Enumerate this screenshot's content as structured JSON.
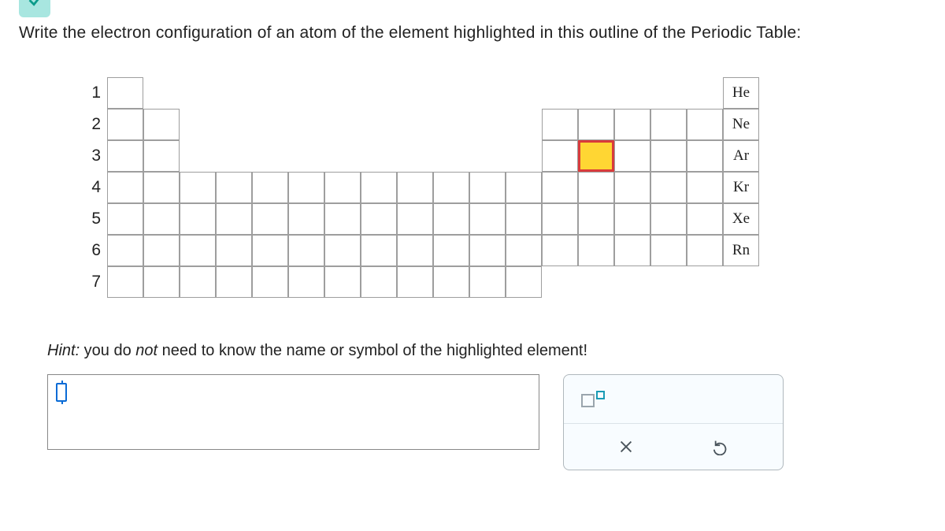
{
  "question": "Write the electron configuration of an atom of the element highlighted in this outline of the Periodic Table:",
  "hint_prefix": "Hint:",
  "hint_text_1": " you do ",
  "hint_not": "not",
  "hint_text_2": " need to know the name or symbol of the highlighted element!",
  "periodic": {
    "rows": [
      "1",
      "2",
      "3",
      "4",
      "5",
      "6",
      "7"
    ],
    "noble_gas_labels": [
      "He",
      "Ne",
      "Ar",
      "Kr",
      "Xe",
      "Rn"
    ],
    "highlighted": {
      "row": 3,
      "group": 14
    }
  },
  "chart_data": {
    "type": "table",
    "description": "Periodic table outline grid, 7 periods x 18 groups",
    "row_labels": [
      1,
      2,
      3,
      4,
      5,
      6,
      7
    ],
    "labeled_cells": [
      {
        "row": 1,
        "group": 18,
        "label": "He"
      },
      {
        "row": 2,
        "group": 18,
        "label": "Ne"
      },
      {
        "row": 3,
        "group": 18,
        "label": "Ar"
      },
      {
        "row": 4,
        "group": 18,
        "label": "Kr"
      },
      {
        "row": 5,
        "group": 18,
        "label": "Xe"
      },
      {
        "row": 6,
        "group": 18,
        "label": "Rn"
      }
    ],
    "highlighted_cell": {
      "row": 3,
      "group": 14,
      "fill": "#ffd633",
      "border": "#d93b3b"
    },
    "cell_layout": {
      "row1_groups": [
        1,
        18
      ],
      "row2_groups": [
        1,
        2,
        13,
        14,
        15,
        16,
        17,
        18
      ],
      "row3_groups": [
        1,
        2,
        13,
        14,
        15,
        16,
        17,
        18
      ],
      "row4_groups": [
        1,
        2,
        3,
        4,
        5,
        6,
        7,
        8,
        9,
        10,
        11,
        12,
        13,
        14,
        15,
        16,
        17,
        18
      ],
      "row5_groups": [
        1,
        2,
        3,
        4,
        5,
        6,
        7,
        8,
        9,
        10,
        11,
        12,
        13,
        14,
        15,
        16,
        17,
        18
      ],
      "row6_groups": [
        1,
        2,
        3,
        4,
        5,
        6,
        7,
        8,
        9,
        10,
        11,
        12,
        13,
        14,
        15,
        16,
        17,
        18
      ],
      "row7_groups": [
        1,
        2,
        3,
        4,
        5,
        6,
        7,
        8,
        9,
        10,
        11,
        12
      ]
    }
  },
  "tools": {
    "superscript": "superscript",
    "clear": "clear",
    "reset": "reset"
  }
}
